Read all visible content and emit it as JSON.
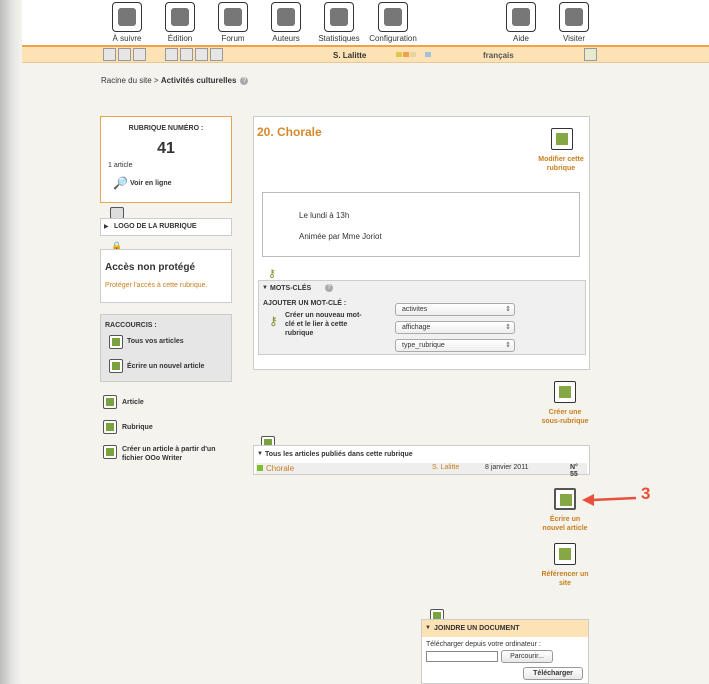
{
  "nav": {
    "items": [
      {
        "label": "À suivre",
        "icon": "follow-icon"
      },
      {
        "label": "Édition",
        "icon": "edit-icon"
      },
      {
        "label": "Forum",
        "icon": "forum-icon"
      },
      {
        "label": "Auteurs",
        "icon": "authors-icon"
      },
      {
        "label": "Statistiques",
        "icon": "statistics-icon"
      },
      {
        "label": "Configuration",
        "icon": "configuration-icon"
      },
      {
        "label": "Aide",
        "icon": "help-icon"
      },
      {
        "label": "Visiter",
        "icon": "visit-icon"
      }
    ]
  },
  "toolbar": {
    "user": "S. Lalitte",
    "language": "français"
  },
  "breadcrumb": {
    "root": "Racine du site",
    "separator": " > ",
    "current": "Activités culturelles"
  },
  "rubrique": {
    "label": "RUBRIQUE NUMÉRO :",
    "number": "41",
    "count": "1 article",
    "view_online": "Voir en ligne"
  },
  "logo": {
    "label": "LOGO DE LA RUBRIQUE"
  },
  "access": {
    "title": "Accès non protégé",
    "link": "Protéger l'accès à cette rubrique."
  },
  "shortcuts": {
    "title": "RACCOURCIS :",
    "items": [
      "Tous vos articles",
      "Écrire un nouvel article"
    ]
  },
  "create_links": [
    "Article",
    "Rubrique",
    "Créer un article à partir d'un fichier OOo Writer"
  ],
  "main": {
    "title": "20. Chorale",
    "modify": "Modifier cette rubrique",
    "text_line1": "Le lundi à 13h",
    "text_line2": "Animée par Mme Joriot"
  },
  "keywords": {
    "title": "MOTS-CLÉS",
    "add_label": "AJOUTER UN MOT-CLÉ :",
    "create_label": "Créer un nouveau mot-clé et le lier à cette rubrique",
    "selects": [
      "activites",
      "affichage",
      "type_rubrique"
    ]
  },
  "create_subrubrique": "Créer une sous-rubrique",
  "articles": {
    "title": "Tous les articles publiés dans cette rubrique",
    "rows": [
      {
        "title": "Chorale",
        "author": "S. Lalitte",
        "date": "8 janvier 2011",
        "number": "N° 55"
      }
    ]
  },
  "new_article": "Écrire un nouvel article",
  "reference_site": "Référencer un site",
  "annotation": {
    "number": "3",
    "color": "#e8503a"
  },
  "document": {
    "title": "JOINDRE UN DOCUMENT",
    "upload_label": "Télécharger depuis votre ordinateur :",
    "browse": "Parcourir...",
    "submit": "Télécharger"
  },
  "colors": {
    "accent": "#f0a24a",
    "toolbar_bg": "#fce2b4",
    "link": "#c87f1e"
  }
}
